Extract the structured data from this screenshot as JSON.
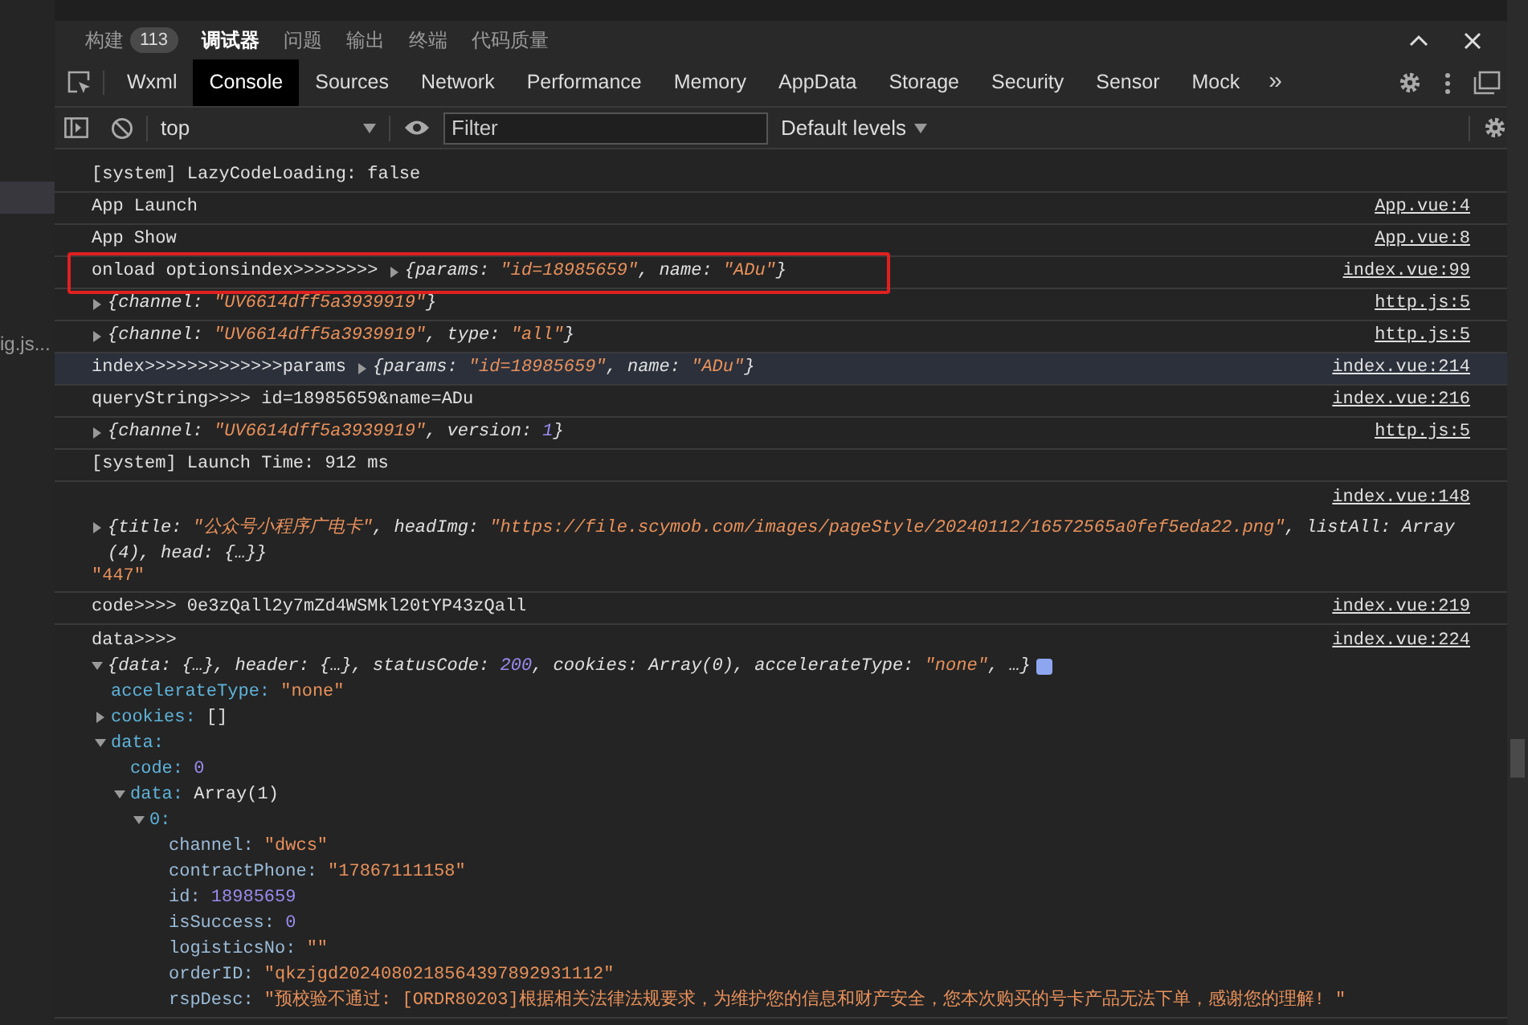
{
  "left_panel": {
    "fragment": "ig.js..."
  },
  "panel_tabs": [
    {
      "label": "构建",
      "badge": "113",
      "selected": false
    },
    {
      "label": "调试器",
      "selected": true
    },
    {
      "label": "问题",
      "selected": false
    },
    {
      "label": "输出",
      "selected": false
    },
    {
      "label": "终端",
      "selected": false
    },
    {
      "label": "代码质量",
      "selected": false
    }
  ],
  "devtools_tabs": [
    {
      "label": "Wxml",
      "selected": false
    },
    {
      "label": "Console",
      "selected": true
    },
    {
      "label": "Sources",
      "selected": false
    },
    {
      "label": "Network",
      "selected": false
    },
    {
      "label": "Performance",
      "selected": false
    },
    {
      "label": "Memory",
      "selected": false
    },
    {
      "label": "AppData",
      "selected": false
    },
    {
      "label": "Storage",
      "selected": false
    },
    {
      "label": "Security",
      "selected": false
    },
    {
      "label": "Sensor",
      "selected": false
    },
    {
      "label": "Mock",
      "selected": false
    }
  ],
  "more_tabs": "»",
  "toolbar": {
    "context": "top",
    "filter_placeholder": "Filter",
    "levels": "Default levels"
  },
  "log": [
    {
      "kind": "inline",
      "selected": false,
      "boxed": false,
      "segments": [
        {
          "kind": "text",
          "text": "[system] LazyCodeLoading: false"
        }
      ]
    },
    {
      "kind": "inline",
      "selected": false,
      "boxed": false,
      "source": "App.vue:4",
      "segments": [
        {
          "kind": "text",
          "text": "App Launch"
        }
      ]
    },
    {
      "kind": "inline",
      "selected": false,
      "boxed": false,
      "source": "App.vue:8",
      "segments": [
        {
          "kind": "text",
          "text": "App Show"
        }
      ]
    },
    {
      "kind": "inline",
      "selected": false,
      "boxed": true,
      "source": "index.vue:99",
      "segments": [
        {
          "kind": "text",
          "text": "onload optionsindex>>>>>>>> "
        },
        {
          "kind": "object",
          "expanded": false,
          "tokens": [
            {
              "kind": "plain",
              "text": "{params: "
            },
            {
              "kind": "string",
              "text": "\"id=18985659\""
            },
            {
              "kind": "plain",
              "text": ", name: "
            },
            {
              "kind": "string",
              "text": "\"ADu\""
            },
            {
              "kind": "plain",
              "text": "}"
            }
          ]
        }
      ]
    },
    {
      "kind": "inline",
      "selected": false,
      "boxed": false,
      "source": "http.js:5",
      "segments": [
        {
          "kind": "object",
          "expanded": false,
          "tokens": [
            {
              "kind": "plain",
              "text": "{channel: "
            },
            {
              "kind": "string",
              "text": "\"UV6614dff5a3939919\""
            },
            {
              "kind": "plain",
              "text": "}"
            }
          ]
        }
      ]
    },
    {
      "kind": "inline",
      "selected": false,
      "boxed": false,
      "source": "http.js:5",
      "segments": [
        {
          "kind": "object",
          "expanded": false,
          "tokens": [
            {
              "kind": "plain",
              "text": "{channel: "
            },
            {
              "kind": "string",
              "text": "\"UV6614dff5a3939919\""
            },
            {
              "kind": "plain",
              "text": ", type: "
            },
            {
              "kind": "string",
              "text": "\"all\""
            },
            {
              "kind": "plain",
              "text": "}"
            }
          ]
        }
      ]
    },
    {
      "kind": "inline",
      "selected": true,
      "boxed": false,
      "source": "index.vue:214",
      "segments": [
        {
          "kind": "text",
          "text": "index>>>>>>>>>>>>>params "
        },
        {
          "kind": "object",
          "expanded": false,
          "tokens": [
            {
              "kind": "plain",
              "text": "{params: "
            },
            {
              "kind": "string",
              "text": "\"id=18985659\""
            },
            {
              "kind": "plain",
              "text": ", name: "
            },
            {
              "kind": "string",
              "text": "\"ADu\""
            },
            {
              "kind": "plain",
              "text": "}"
            }
          ]
        }
      ]
    },
    {
      "kind": "inline",
      "selected": false,
      "boxed": false,
      "source": "index.vue:216",
      "segments": [
        {
          "kind": "text",
          "text": "queryString>>>> id=18985659&name=ADu"
        }
      ]
    },
    {
      "kind": "inline",
      "selected": false,
      "boxed": false,
      "source": "http.js:5",
      "segments": [
        {
          "kind": "object",
          "expanded": false,
          "tokens": [
            {
              "kind": "plain",
              "text": "{channel: "
            },
            {
              "kind": "string",
              "text": "\"UV6614dff5a3939919\""
            },
            {
              "kind": "plain",
              "text": ", version: "
            },
            {
              "kind": "number",
              "text": "1"
            },
            {
              "kind": "plain",
              "text": "}"
            }
          ]
        }
      ]
    },
    {
      "kind": "inline",
      "selected": false,
      "boxed": false,
      "segments": [
        {
          "kind": "text",
          "text": "[system] Launch Time: 912 ms"
        }
      ]
    },
    {
      "kind": "stacked",
      "selected": false,
      "boxed": false,
      "source": "index.vue:148",
      "segments": [
        {
          "kind": "object",
          "expanded": false,
          "tokens": [
            {
              "kind": "plain",
              "text": "{title: "
            },
            {
              "kind": "string",
              "text": "\"公众号小程序广电卡\""
            },
            {
              "kind": "plain",
              "text": ", headImg: "
            },
            {
              "kind": "string",
              "text": "\"https://file.scymob.com/images/pageStyle/20240112/16572565a0fef5eda22.png\""
            },
            {
              "kind": "plain",
              "text": ", listAll: Array(4), head: {…}}"
            }
          ]
        },
        {
          "kind": "string",
          "text": "\"447\""
        }
      ]
    },
    {
      "kind": "inline",
      "selected": false,
      "boxed": false,
      "source": "index.vue:219",
      "segments": [
        {
          "kind": "text",
          "text": "code>>>> 0e3zQall2y7mZd4WSMkl20tYP43zQall"
        }
      ]
    },
    {
      "kind": "stacked",
      "selected": false,
      "boxed": false,
      "source": "index.vue:224",
      "segments": [
        {
          "kind": "text",
          "text": "data>>>>"
        },
        {
          "kind": "object",
          "expanded": true,
          "info": true,
          "tokens": [
            {
              "kind": "plain",
              "text": "{data: {…}, header: {…}, statusCode: "
            },
            {
              "kind": "number",
              "text": "200"
            },
            {
              "kind": "plain",
              "text": ", cookies: Array(0), accelerateType: "
            },
            {
              "kind": "string",
              "text": "\"none\""
            },
            {
              "kind": "plain",
              "text": ", …}"
            }
          ],
          "children": [
            {
              "key": "accelerateType:",
              "value": {
                "kind": "string",
                "text": "\"none\""
              }
            },
            {
              "key": "cookies:",
              "expanded": false,
              "value": {
                "kind": "plain",
                "text": "[]"
              }
            },
            {
              "key": "data:",
              "expanded": true,
              "children": [
                {
                  "key": "code:",
                  "value": {
                    "kind": "number",
                    "text": "0"
                  }
                },
                {
                  "key": "data:",
                  "expanded": true,
                  "value": {
                    "kind": "plain",
                    "text": "Array(1)"
                  },
                  "children": [
                    {
                      "key": "0:",
                      "expanded": true,
                      "children": [
                        {
                          "key": "channel:",
                          "value": {
                            "kind": "string",
                            "text": "\"dwcs\""
                          }
                        },
                        {
                          "key": "contractPhone:",
                          "value": {
                            "kind": "string",
                            "text": "\"17867111158\""
                          }
                        },
                        {
                          "key": "id:",
                          "value": {
                            "kind": "number",
                            "text": "18985659"
                          }
                        },
                        {
                          "key": "isSuccess:",
                          "value": {
                            "kind": "number",
                            "text": "0"
                          }
                        },
                        {
                          "key": "logisticsNo:",
                          "value": {
                            "kind": "string",
                            "text": "\"\""
                          }
                        },
                        {
                          "key": "orderID:",
                          "value": {
                            "kind": "string",
                            "text": "\"qkzjgd2024080218564397892931112\""
                          }
                        },
                        {
                          "key": "rspDesc:",
                          "value": {
                            "kind": "string",
                            "text": "\"预校验不通过: [ORDR80203]根据相关法律法规要求，为维护您的信息和财产安全，您本次购买的号卡产品无法下单，感谢您的理解! \""
                          }
                        }
                      ]
                    }
                  ]
                }
              ]
            }
          ]
        }
      ]
    }
  ]
}
